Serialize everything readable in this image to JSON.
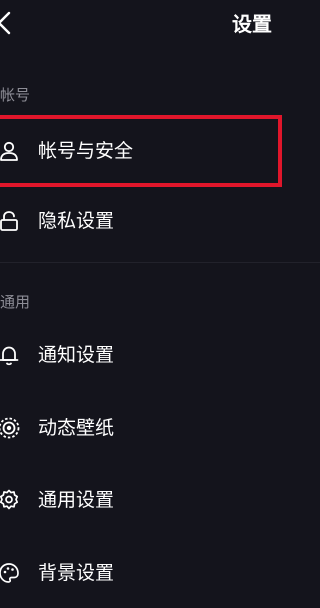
{
  "header": {
    "back_icon": "chevron-left-icon",
    "title": "设置"
  },
  "sections": [
    {
      "title": "帐号",
      "items": [
        {
          "label": "帐号与安全",
          "icon": "user-icon",
          "highlighted": true
        },
        {
          "label": "隐私设置",
          "icon": "lock-icon"
        }
      ]
    },
    {
      "title": "通用",
      "items": [
        {
          "label": "通知设置",
          "icon": "bell-icon"
        },
        {
          "label": "动态壁纸",
          "icon": "live-wallpaper-icon"
        },
        {
          "label": "通用设置",
          "icon": "gear-icon"
        },
        {
          "label": "背景设置",
          "icon": "palette-icon"
        }
      ]
    }
  ],
  "colors": {
    "background": "#14141c",
    "text": "#ffffff",
    "section_title": "#8d8d96",
    "highlight": "#e0162b"
  }
}
